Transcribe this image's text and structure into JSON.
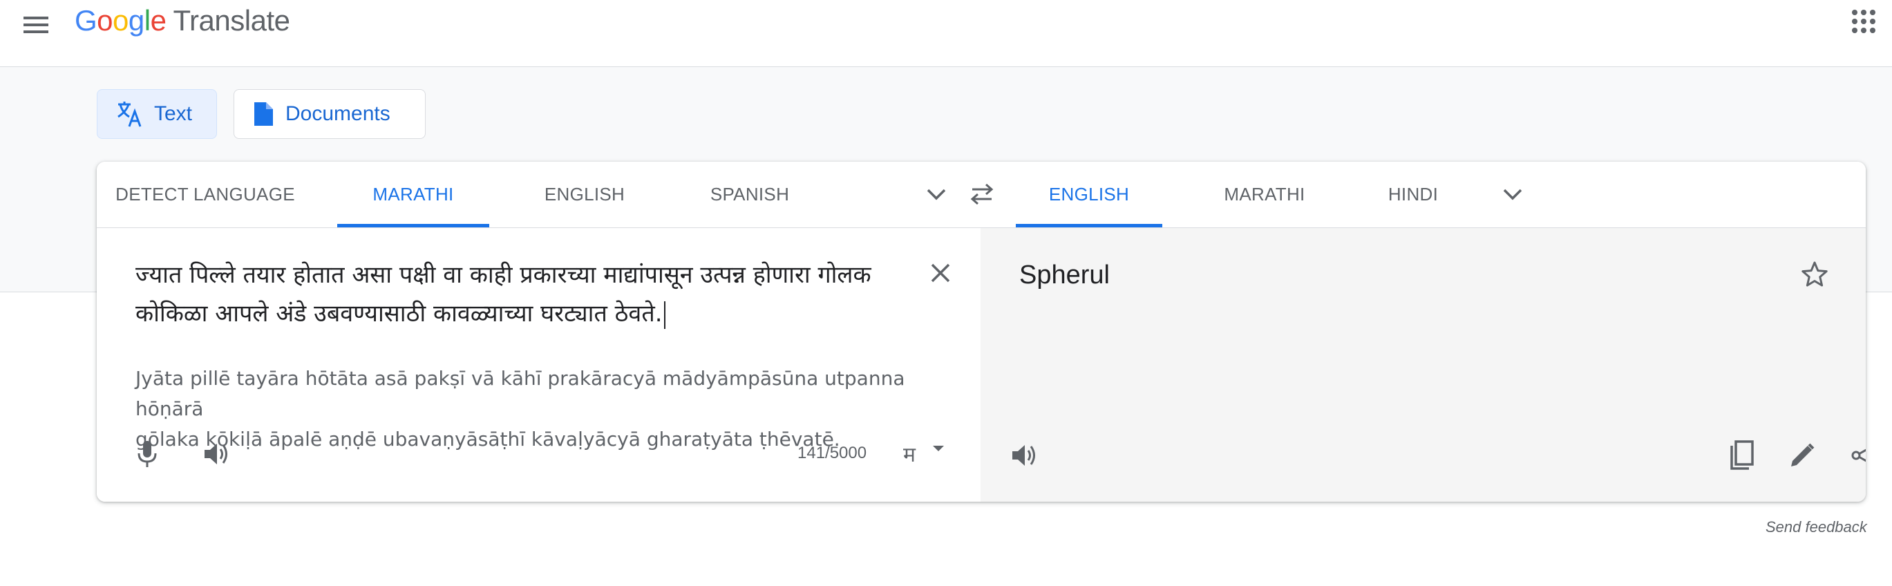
{
  "header": {
    "logo_google": [
      "G",
      "o",
      "o",
      "g",
      "l",
      "e"
    ],
    "product_name": "Translate",
    "menu_icon": "menu-icon",
    "apps_icon": "apps-grid-icon"
  },
  "modes": {
    "text_label": "Text",
    "documents_label": "Documents",
    "active": "Text"
  },
  "source_languages": {
    "tabs": [
      "DETECT LANGUAGE",
      "MARATHI",
      "ENGLISH",
      "SPANISH"
    ],
    "selected": "MARATHI"
  },
  "target_languages": {
    "tabs": [
      "ENGLISH",
      "MARATHI",
      "HINDI"
    ],
    "selected": "ENGLISH"
  },
  "source": {
    "text_line1": "ज्यात पिल्ले तयार होतात असा पक्षी वा काही प्रकारच्या माद्यांपासून उत्पन्न होणारा गोलक",
    "text_line2": "कोकिळा आपले अंडे उबवण्यासाठी कावळ्याच्या घरट्यात ठेवते.",
    "transliteration_line1": "Jyāta pillē tayāra hōtāta asā pakṣī vā kāhī prakāracyā mādyāmpāsūna utpanna hōṇārā",
    "transliteration_line2": "gōlaka kōkiḷā āpalē aṇḍē ubavaṇyāsāṭhī kāvaḷyācyā gharaṭyāta ṭhēvatē.",
    "char_count": "141/5000",
    "input_tool_glyph": "म"
  },
  "target": {
    "translation": "Spherul"
  },
  "footer": {
    "feedback": "Send feedback"
  },
  "colors": {
    "accent": "#1a73e8",
    "icon_grey": "#5f6368",
    "band_bg": "#f8f9fa",
    "target_bg": "#f5f5f5"
  }
}
